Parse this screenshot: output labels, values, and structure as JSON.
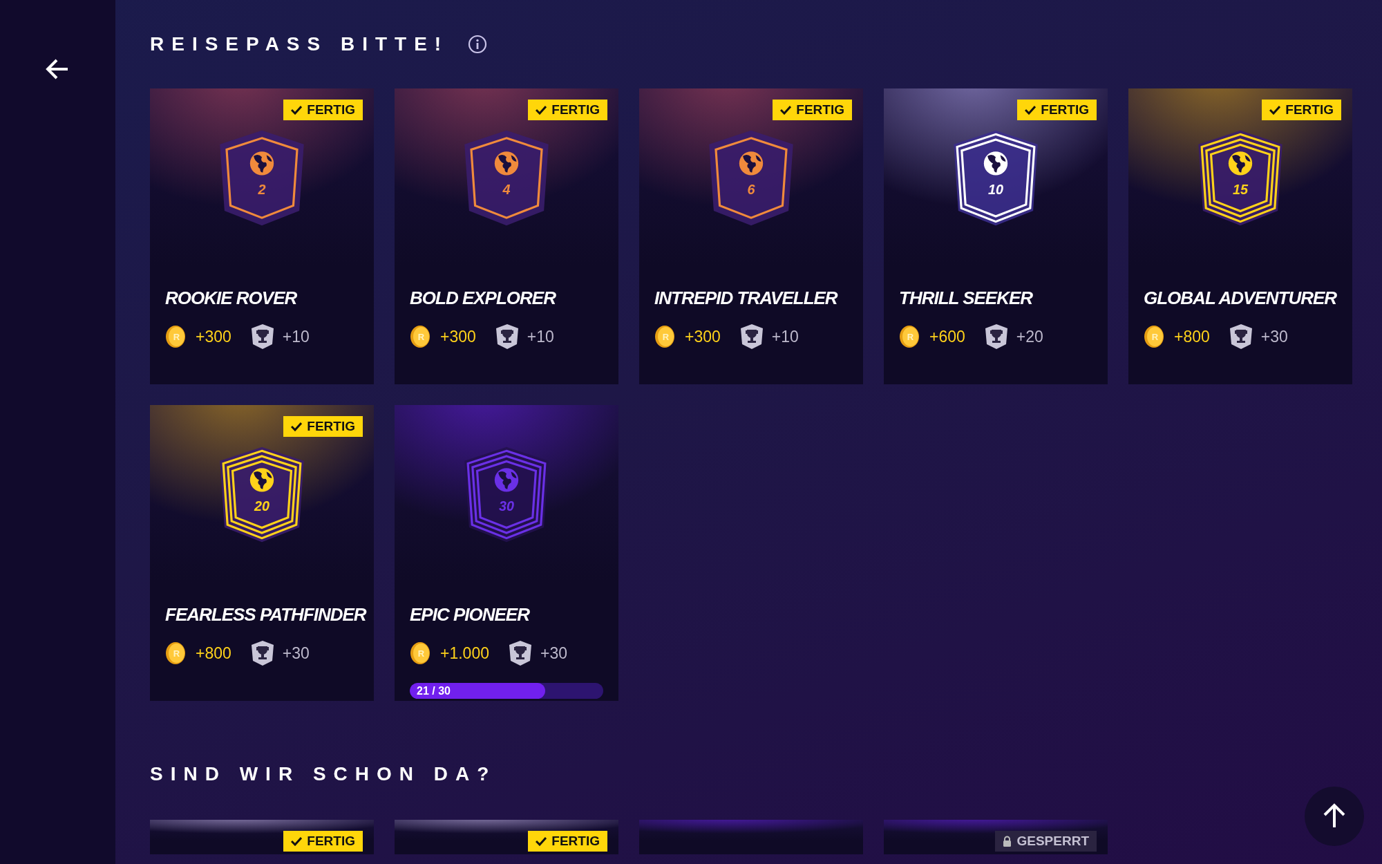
{
  "sections": [
    {
      "title": "REISEPASS BITTE!",
      "has_info": true,
      "cards": [
        {
          "title": "ROOKIE ROVER",
          "badge_number": "2",
          "kind": "orange",
          "completed": true,
          "locked": false,
          "tag": "FERTIG",
          "coin_symbol": "R",
          "coins": "+300",
          "trophies": "+10"
        },
        {
          "title": "BOLD EXPLORER",
          "badge_number": "4",
          "kind": "orange",
          "completed": true,
          "locked": false,
          "tag": "FERTIG",
          "coin_symbol": "R",
          "coins": "+300",
          "trophies": "+10"
        },
        {
          "title": "INTREPID TRAVELLER",
          "badge_number": "6",
          "kind": "orange",
          "completed": true,
          "locked": false,
          "tag": "FERTIG",
          "coin_symbol": "R",
          "coins": "+300",
          "trophies": "+10"
        },
        {
          "title": "THRILL SEEKER",
          "badge_number": "10",
          "kind": "silver",
          "completed": true,
          "locked": false,
          "tag": "FERTIG",
          "coin_symbol": "R",
          "coins": "+600",
          "trophies": "+20"
        },
        {
          "title": "GLOBAL ADVENTURER",
          "badge_number": "15",
          "kind": "gold",
          "completed": true,
          "locked": false,
          "tag": "FERTIG",
          "coin_symbol": "R",
          "coins": "+800",
          "trophies": "+30"
        },
        {
          "title": "FEARLESS PATHFINDER",
          "badge_number": "20",
          "kind": "gold",
          "completed": true,
          "locked": false,
          "tag": "FERTIG",
          "coin_symbol": "R",
          "coins": "+800",
          "trophies": "+30"
        },
        {
          "title": "EPIC PIONEER",
          "badge_number": "30",
          "kind": "purple",
          "completed": false,
          "locked": false,
          "coin_symbol": "R",
          "coins": "+1.000",
          "trophies": "+30",
          "progress_text": "21 / 30",
          "level": 0.7
        }
      ]
    },
    {
      "title": "SIND WIR SCHON DA?",
      "cards": [
        {
          "kind": "grey",
          "completed": true,
          "locked": false,
          "tag": "FERTIG"
        },
        {
          "kind": "grey",
          "completed": true,
          "locked": false,
          "tag": "FERTIG"
        },
        {
          "kind": "purple",
          "completed": false,
          "locked": false
        },
        {
          "kind": "purple",
          "completed": false,
          "locked": true,
          "tag": "GESPERRT"
        }
      ]
    }
  ]
}
